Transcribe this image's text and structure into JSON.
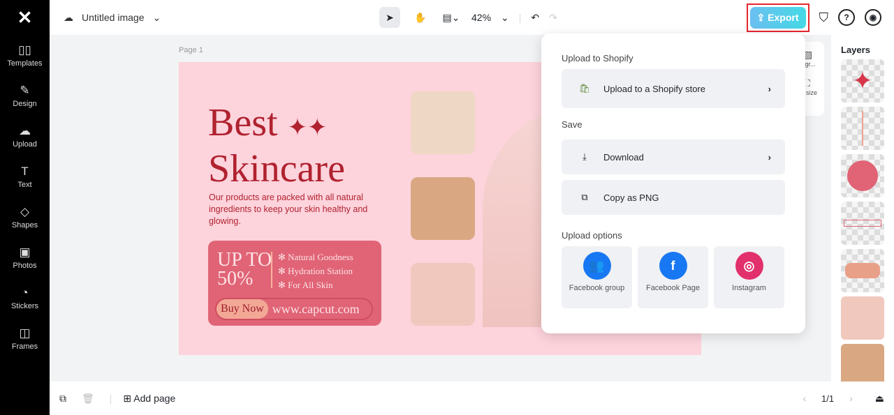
{
  "app": {
    "logo": "CapCut"
  },
  "sidebar": {
    "items": [
      {
        "label": "Templates",
        "icon": "templates-icon",
        "g": "▯▯"
      },
      {
        "label": "Design",
        "icon": "design-icon",
        "g": "✎"
      },
      {
        "label": "Upload",
        "icon": "upload-icon",
        "g": "☁"
      },
      {
        "label": "Text",
        "icon": "text-icon",
        "g": "T"
      },
      {
        "label": "Shapes",
        "icon": "shapes-icon",
        "g": "◇"
      },
      {
        "label": "Photos",
        "icon": "photos-icon",
        "g": "▣"
      },
      {
        "label": "Stickers",
        "icon": "stickers-icon",
        "g": "◔"
      },
      {
        "label": "Frames",
        "icon": "frames-icon",
        "g": "◫"
      }
    ]
  },
  "header": {
    "title": "Untitled image",
    "zoom": "42%",
    "export": "Export"
  },
  "canvas": {
    "page_label": "Page 1",
    "headline1": "Best",
    "headline2": "Skincare",
    "description": "Our products are packed with all natural ingredients to keep your skin healthy and glowing.",
    "promo": {
      "upto": "UP TO",
      "percent": "50%",
      "features": [
        "Natural Goodness",
        "Hydration Station",
        "For All Skin"
      ],
      "buy": "Buy Now",
      "url": "www.capcut.com"
    }
  },
  "export_menu": {
    "shopify_section": "Upload to Shopify",
    "shopify": "Upload to a Shopify store",
    "save_section": "Save",
    "download": "Download",
    "copy": "Copy as PNG",
    "upload_section": "Upload options",
    "options": [
      {
        "label": "Facebook group",
        "color": "#1877f2"
      },
      {
        "label": "Facebook Page",
        "color": "#1877f2"
      },
      {
        "label": "Instagram",
        "color": "#e1306c"
      }
    ]
  },
  "tool_panel": {
    "background": "Bkgr...",
    "resize": "size"
  },
  "layers": {
    "title": "Layers"
  },
  "footer": {
    "add_page": "Add page",
    "pages": "1/1"
  }
}
